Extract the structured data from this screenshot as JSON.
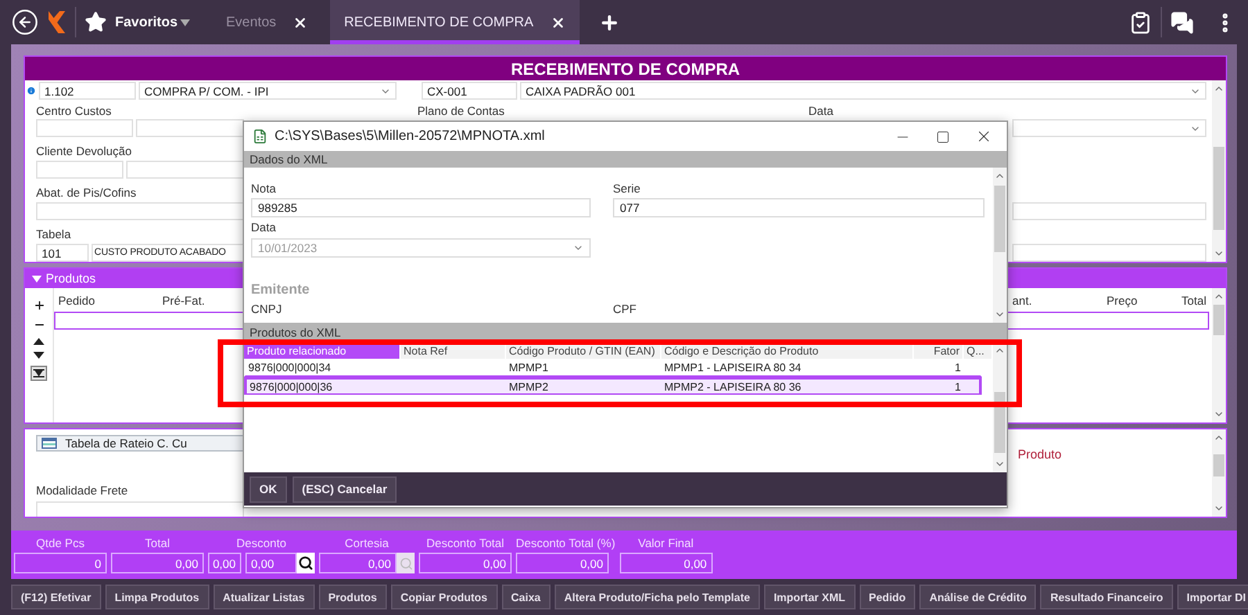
{
  "top_bar": {
    "favorites": "Favoritos",
    "tabs": [
      {
        "label": "Eventos",
        "selected": false
      },
      {
        "label": "RECEBIMENTO DE COMPRA",
        "selected": true
      }
    ]
  },
  "form": {
    "title": "RECEBIMENTO DE COMPRA",
    "operation_code": "1.102",
    "operation_name": "COMPRA P/ COM. - IPI",
    "cashier_code": "CX-001",
    "cashier_name": "CAIXA PADRÃO 001",
    "cost_center_label": "Centro Custos",
    "accounts_label": "Plano de Contas",
    "date_label": "Data",
    "return_client_label": "Cliente Devolução",
    "pis_cofins_label": "Abat. de Pis/Cofins",
    "table_label": "Tabela",
    "table_code": "101",
    "table_name": "CUSTO PRODUTO ACABADO"
  },
  "products": {
    "title": "Produtos",
    "columns_left": [
      "Pedido",
      "Pré-Fat."
    ],
    "columns_right": [
      "ant.",
      "Preço",
      "Total"
    ]
  },
  "lower": {
    "apportion_button": "Tabela de Rateio C. Cu",
    "product_label": "Produto",
    "freight_label": "Modalidade Frete"
  },
  "totals": [
    {
      "label": "Qtde Pcs",
      "kind": "field",
      "values": [
        "0"
      ]
    },
    {
      "label": "Total",
      "kind": "field",
      "values": [
        "0,00"
      ]
    },
    {
      "label": "Desconto",
      "kind": "search",
      "values": [
        "0,00",
        "0,00"
      ]
    },
    {
      "label": "Cortesia",
      "kind": "dimmed",
      "values": [
        "0,00"
      ]
    },
    {
      "label": "Desconto Total",
      "kind": "field",
      "values": [
        "0,00"
      ]
    },
    {
      "label": "Desconto Total (%)",
      "kind": "field",
      "values": [
        "0,00"
      ]
    },
    {
      "label": "Valor Final",
      "kind": "field",
      "values": [
        "0,00"
      ]
    }
  ],
  "actions": [
    "(F12) Efetivar",
    "Limpa Produtos",
    "Atualizar Listas",
    "Produtos",
    "Copiar Produtos",
    "Caixa",
    "Altera Produto/Ficha pelo Template",
    "Importar XML",
    "Pedido",
    "Análise de Crédito",
    "Resultado Financeiro",
    "Importar DI"
  ],
  "dialog": {
    "title": "C:\\SYS\\Bases\\5\\Millen-20572\\MPNOTA.xml",
    "data_section": "Dados do XML",
    "nota_label": "Nota",
    "nota": "989285",
    "serie_label": "Serie",
    "serie": "077",
    "date_label": "Data",
    "date": "10/01/2023",
    "issuer_label": "Emitente",
    "cnpj_label": "CNPJ",
    "cpf_label": "CPF",
    "products_section": "Produtos do XML",
    "columns": [
      {
        "label": "Produto relacionado",
        "selected": true
      },
      {
        "label": "Nota Ref",
        "selected": false
      },
      {
        "label": "Código Produto / GTIN (EAN)",
        "selected": false
      },
      {
        "label": "Código e Descrição do Produto",
        "selected": false
      },
      {
        "label": "Fator",
        "selected": false
      },
      {
        "label": "Q...",
        "selected": false
      }
    ],
    "rows": [
      {
        "product": "9876|000|000|34",
        "code": "MPMP1",
        "description": "MPMP1 - LAPISEIRA 80 34",
        "factor": "1",
        "selected": false
      },
      {
        "product": "9876|000|000|36",
        "code": "MPMP2",
        "description": "MPMP2 - LAPISEIRA 80 36",
        "factor": "1",
        "selected": true
      }
    ],
    "buttons": [
      "OK",
      "(ESC) Cancelar"
    ]
  }
}
